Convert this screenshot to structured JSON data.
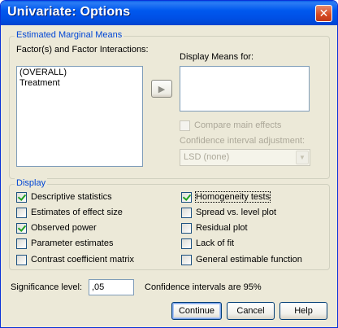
{
  "window": {
    "title": "Univariate: Options",
    "close_glyph": "✕"
  },
  "emm": {
    "legend": "Estimated Marginal Means",
    "factors_label": "Factor(s) and Factor Interactions:",
    "factors_items": [
      "(OVERALL)",
      "Treatment"
    ],
    "move_glyph": "▶",
    "display_means_label": "Display Means for:",
    "compare_label": "Compare main effects",
    "ci_adjust_label": "Confidence interval adjustment:",
    "ci_adjust_value": "LSD (none)",
    "combo_glyph": "▼"
  },
  "display": {
    "legend": "Display",
    "options": [
      {
        "label": "Descriptive statistics",
        "checked": true
      },
      {
        "label": "Estimates of effect size",
        "checked": false
      },
      {
        "label": "Observed power",
        "checked": true
      },
      {
        "label": "Parameter estimates",
        "checked": false
      },
      {
        "label": "Contrast coefficient matrix",
        "checked": false
      },
      {
        "label": "Homogeneity tests",
        "checked": true
      },
      {
        "label": "Spread vs. level plot",
        "checked": false
      },
      {
        "label": "Residual plot",
        "checked": false
      },
      {
        "label": "Lack of fit",
        "checked": false
      },
      {
        "label": "General estimable function",
        "checked": false
      }
    ]
  },
  "significance": {
    "label": "Significance level:",
    "value": ",05",
    "ci_note": "Confidence intervals are 95%"
  },
  "buttons": {
    "continue": "Continue",
    "cancel": "Cancel",
    "help": "Help"
  },
  "colors": {
    "title_bar": "#0058ee",
    "group_legend": "#0046d5",
    "face": "#ece9d8",
    "check": "#21a121"
  }
}
